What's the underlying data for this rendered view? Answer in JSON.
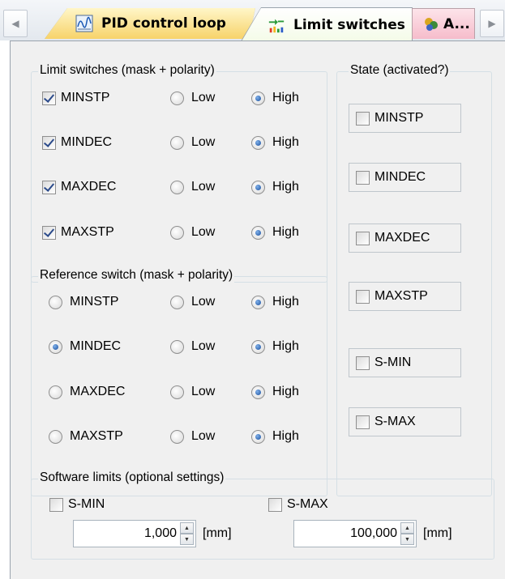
{
  "tabs": [
    {
      "label": "PID control loop",
      "icon": "pid-chart-icon"
    },
    {
      "label": "Limit switches",
      "icon": "limit-switch-icon"
    },
    {
      "label": "A...",
      "icon": "axis-icon"
    }
  ],
  "limit_switches": {
    "title": "Limit switches (mask + polarity)",
    "rows": [
      {
        "name": "MINSTP",
        "enabled": true,
        "low": "Low",
        "high": "High",
        "polarity": "High"
      },
      {
        "name": "MINDEC",
        "enabled": true,
        "low": "Low",
        "high": "High",
        "polarity": "High"
      },
      {
        "name": "MAXDEC",
        "enabled": true,
        "low": "Low",
        "high": "High",
        "polarity": "High"
      },
      {
        "name": "MAXSTP",
        "enabled": true,
        "low": "Low",
        "high": "High",
        "polarity": "High"
      }
    ]
  },
  "reference_switch": {
    "title": "Reference switch (mask + polarity)",
    "selected": "MINDEC",
    "rows": [
      {
        "name": "MINSTP",
        "low": "Low",
        "high": "High",
        "polarity": "High"
      },
      {
        "name": "MINDEC",
        "low": "Low",
        "high": "High",
        "polarity": "High"
      },
      {
        "name": "MAXDEC",
        "low": "Low",
        "high": "High",
        "polarity": "High"
      },
      {
        "name": "MAXSTP",
        "low": "Low",
        "high": "High",
        "polarity": "High"
      }
    ]
  },
  "state": {
    "title": "State (activated?)",
    "items": [
      {
        "name": "MINSTP",
        "active": false
      },
      {
        "name": "MINDEC",
        "active": false
      },
      {
        "name": "MAXDEC",
        "active": false
      },
      {
        "name": "MAXSTP",
        "active": false
      },
      {
        "name": "S-MIN",
        "active": false
      },
      {
        "name": "S-MAX",
        "active": false
      }
    ]
  },
  "software_limits": {
    "title": "Software limits (optional settings)",
    "smin": {
      "label": "S-MIN",
      "enabled": false,
      "value": "1,000",
      "unit": "[mm]"
    },
    "smax": {
      "label": "S-MAX",
      "enabled": false,
      "value": "100,000",
      "unit": "[mm]"
    }
  },
  "colors": {
    "active_tab": "#fde9a8",
    "pane": "#f0f0f0",
    "radio_dot": "#1a4f9c"
  }
}
